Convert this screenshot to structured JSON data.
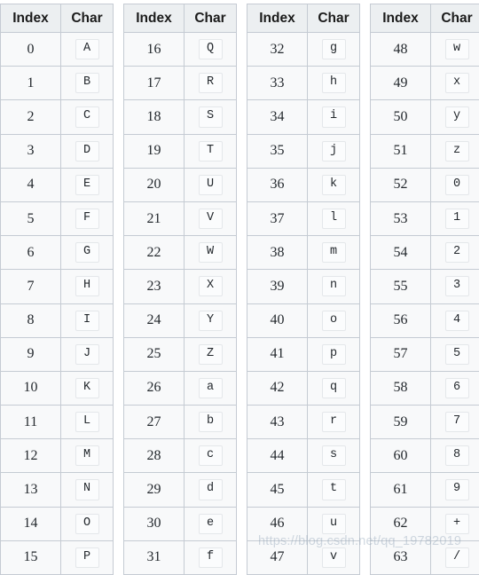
{
  "page": {
    "title": "Base64 Index and Character Mapping Table",
    "background_color": "#ffffff"
  },
  "watermark": {
    "text": "https://blog.csdn.net/qq_19782019",
    "color": "#8ca0b4"
  },
  "columns": {
    "index_label": "Index",
    "char_label": "Char"
  },
  "tables": [
    {
      "name": "table-0-15",
      "headers": [
        "Index",
        "Char"
      ],
      "rows": [
        {
          "index": "0",
          "char": "A"
        },
        {
          "index": "1",
          "char": "B"
        },
        {
          "index": "2",
          "char": "C"
        },
        {
          "index": "3",
          "char": "D"
        },
        {
          "index": "4",
          "char": "E"
        },
        {
          "index": "5",
          "char": "F"
        },
        {
          "index": "6",
          "char": "G"
        },
        {
          "index": "7",
          "char": "H"
        },
        {
          "index": "8",
          "char": "I"
        },
        {
          "index": "9",
          "char": "J"
        },
        {
          "index": "10",
          "char": "K"
        },
        {
          "index": "11",
          "char": "L"
        },
        {
          "index": "12",
          "char": "M"
        },
        {
          "index": "13",
          "char": "N"
        },
        {
          "index": "14",
          "char": "O"
        },
        {
          "index": "15",
          "char": "P"
        }
      ]
    },
    {
      "name": "table-16-31",
      "headers": [
        "Index",
        "Char"
      ],
      "rows": [
        {
          "index": "16",
          "char": "Q"
        },
        {
          "index": "17",
          "char": "R"
        },
        {
          "index": "18",
          "char": "S"
        },
        {
          "index": "19",
          "char": "T"
        },
        {
          "index": "20",
          "char": "U"
        },
        {
          "index": "21",
          "char": "V"
        },
        {
          "index": "22",
          "char": "W"
        },
        {
          "index": "23",
          "char": "X"
        },
        {
          "index": "24",
          "char": "Y"
        },
        {
          "index": "25",
          "char": "Z"
        },
        {
          "index": "26",
          "char": "a"
        },
        {
          "index": "27",
          "char": "b"
        },
        {
          "index": "28",
          "char": "c"
        },
        {
          "index": "29",
          "char": "d"
        },
        {
          "index": "30",
          "char": "e"
        },
        {
          "index": "31",
          "char": "f"
        }
      ]
    },
    {
      "name": "table-32-47",
      "headers": [
        "Index",
        "Char"
      ],
      "rows": [
        {
          "index": "32",
          "char": "g"
        },
        {
          "index": "33",
          "char": "h"
        },
        {
          "index": "34",
          "char": "i"
        },
        {
          "index": "35",
          "char": "j"
        },
        {
          "index": "36",
          "char": "k"
        },
        {
          "index": "37",
          "char": "l"
        },
        {
          "index": "38",
          "char": "m"
        },
        {
          "index": "39",
          "char": "n"
        },
        {
          "index": "40",
          "char": "o"
        },
        {
          "index": "41",
          "char": "p"
        },
        {
          "index": "42",
          "char": "q"
        },
        {
          "index": "43",
          "char": "r"
        },
        {
          "index": "44",
          "char": "s"
        },
        {
          "index": "45",
          "char": "t"
        },
        {
          "index": "46",
          "char": "u"
        },
        {
          "index": "47",
          "char": "v"
        }
      ]
    },
    {
      "name": "table-48-63",
      "headers": [
        "Index",
        "Char"
      ],
      "rows": [
        {
          "index": "48",
          "char": "w"
        },
        {
          "index": "49",
          "char": "x"
        },
        {
          "index": "50",
          "char": "y"
        },
        {
          "index": "51",
          "char": "z"
        },
        {
          "index": "52",
          "char": "0"
        },
        {
          "index": "53",
          "char": "1"
        },
        {
          "index": "54",
          "char": "2"
        },
        {
          "index": "55",
          "char": "3"
        },
        {
          "index": "56",
          "char": "4"
        },
        {
          "index": "57",
          "char": "5"
        },
        {
          "index": "58",
          "char": "6"
        },
        {
          "index": "59",
          "char": "7"
        },
        {
          "index": "60",
          "char": "8"
        },
        {
          "index": "61",
          "char": "9"
        },
        {
          "index": "62",
          "char": "+"
        },
        {
          "index": "63",
          "char": "/"
        }
      ]
    }
  ]
}
